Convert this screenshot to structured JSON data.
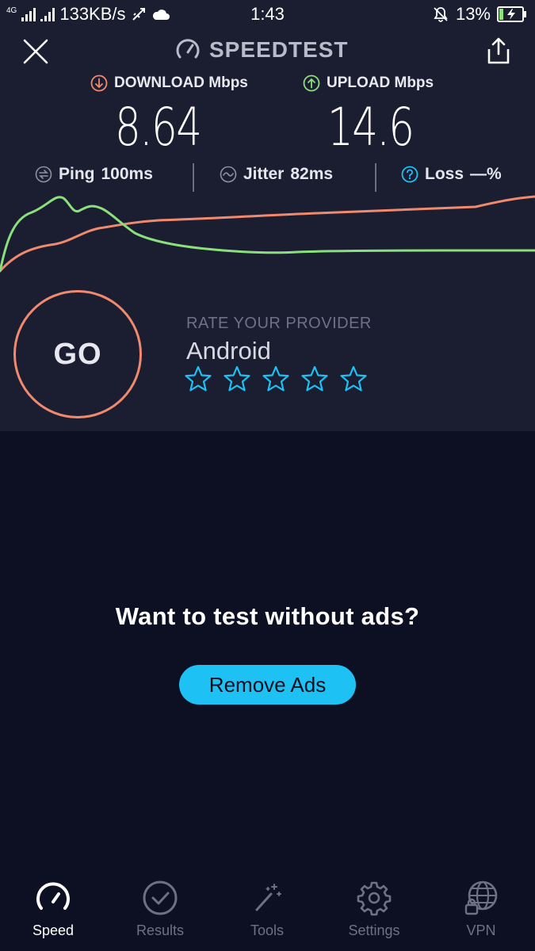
{
  "status_bar": {
    "network": "4G",
    "speed": "133KB/s",
    "time": "1:43",
    "battery": "13%"
  },
  "header": {
    "title": "SPEEDTEST"
  },
  "metrics": {
    "download_label": "DOWNLOAD Mbps",
    "download_value": "8.64",
    "upload_label": "UPLOAD Mbps",
    "upload_value": "14.6"
  },
  "stats": {
    "ping_label": "Ping",
    "ping_value": "100ms",
    "jitter_label": "Jitter",
    "jitter_value": "82ms",
    "loss_label": "Loss",
    "loss_value": "—%"
  },
  "rating": {
    "go_label": "GO",
    "rate_label": "RATE YOUR PROVIDER",
    "provider": "Android",
    "stars_total": 5,
    "stars_filled": 0
  },
  "promo": {
    "title": "Want to test without ads?",
    "button": "Remove Ads"
  },
  "nav": {
    "items": [
      {
        "label": "Speed",
        "icon": "speedometer-icon",
        "active": true
      },
      {
        "label": "Results",
        "icon": "checkmark-circle-icon",
        "active": false
      },
      {
        "label": "Tools",
        "icon": "magic-wand-icon",
        "active": false
      },
      {
        "label": "Settings",
        "icon": "gear-icon",
        "active": false
      },
      {
        "label": "VPN",
        "icon": "globe-lock-icon",
        "active": false
      }
    ]
  },
  "colors": {
    "download": "#f08a6f",
    "upload": "#8ae07a",
    "accent": "#1ec1f3",
    "background": "#0d1022",
    "panel": "#1b1d31"
  }
}
